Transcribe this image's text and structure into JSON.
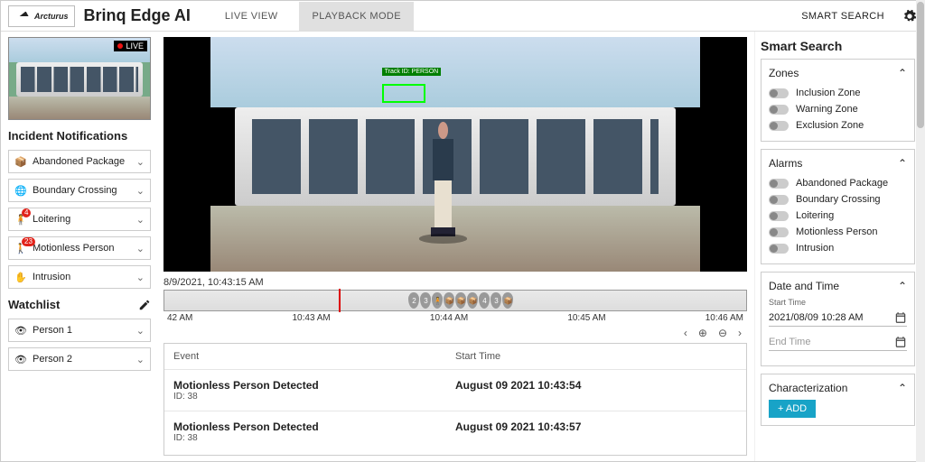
{
  "brand": {
    "company": "Arcturus",
    "app": "Brinq Edge AI"
  },
  "tabs": {
    "live": "LIVE VIEW",
    "playback": "PLAYBACK MODE",
    "active": "playback"
  },
  "header": {
    "smart_search": "SMART SEARCH"
  },
  "live_badge": "LIVE",
  "incidents": {
    "title": "Incident Notifications",
    "items": [
      {
        "label": "Abandoned Package",
        "icon": "package-icon",
        "badge": null
      },
      {
        "label": "Boundary Crossing",
        "icon": "globe-icon",
        "badge": null
      },
      {
        "label": "Loitering",
        "icon": "person-stand-icon",
        "badge": "4"
      },
      {
        "label": "Motionless Person",
        "icon": "person-down-icon",
        "badge": "23"
      },
      {
        "label": "Intrusion",
        "icon": "hand-icon",
        "badge": null
      }
    ]
  },
  "watchlist": {
    "title": "Watchlist",
    "items": [
      {
        "label": "Person 1"
      },
      {
        "label": "Person 2"
      }
    ]
  },
  "playback": {
    "timestamp": "8/9/2021, 10:43:15 AM",
    "detection_label": "Track ID: PERSON",
    "ticks": [
      "42 AM",
      "10:43 AM",
      "10:44 AM",
      "10:45 AM",
      "10:46 AM"
    ],
    "markers": [
      "2",
      "3",
      "",
      "",
      "",
      "",
      "4",
      "3",
      ""
    ]
  },
  "events": {
    "columns": {
      "event": "Event",
      "start": "Start Time"
    },
    "rows": [
      {
        "title": "Motionless Person Detected",
        "sub": "ID: 38",
        "time": "August 09 2021 10:43:54"
      },
      {
        "title": "Motionless Person Detected",
        "sub": "ID: 38",
        "time": "August 09 2021 10:43:57"
      }
    ]
  },
  "search": {
    "title": "Smart Search",
    "zones": {
      "title": "Zones",
      "items": [
        "Inclusion Zone",
        "Warning Zone",
        "Exclusion Zone"
      ]
    },
    "alarms": {
      "title": "Alarms",
      "items": [
        "Abandoned Package",
        "Boundary Crossing",
        "Loitering",
        "Motionless Person",
        "Intrusion"
      ]
    },
    "datetime": {
      "title": "Date and Time",
      "start_label": "Start Time",
      "start_value": "2021/08/09 10:28 AM",
      "end_label": "End Time",
      "end_placeholder": "End Time"
    },
    "characterization": {
      "title": "Characterization",
      "add": "+  ADD"
    }
  }
}
